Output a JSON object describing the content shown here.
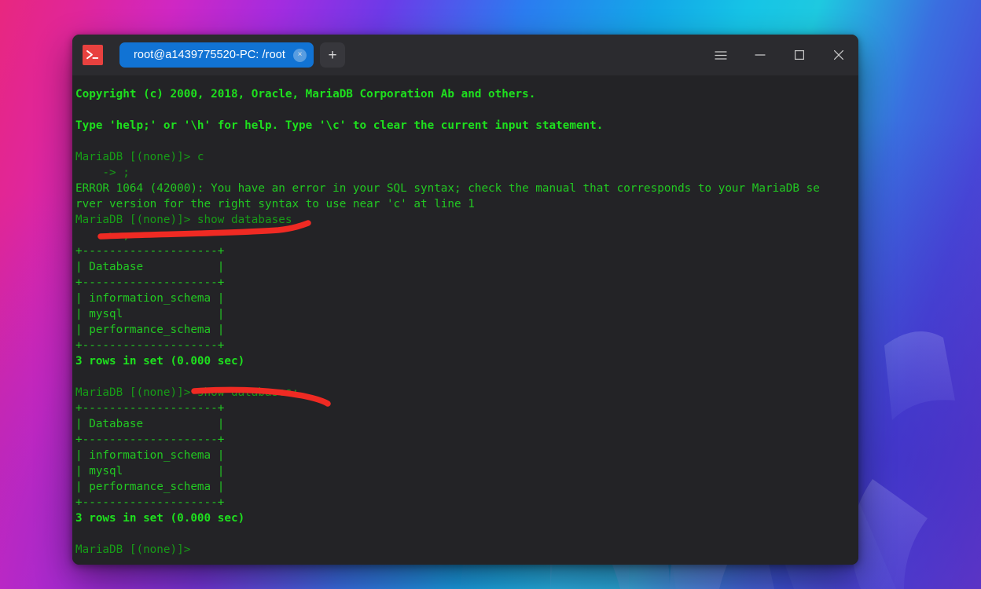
{
  "window": {
    "app_icon": "terminal-prompt-icon",
    "tab": {
      "title": "root@a1439775520-PC: /root",
      "close_label": "×"
    },
    "new_tab_label": "+",
    "controls": {
      "menu": "hamburger-menu-icon",
      "minimize": "minimize-icon",
      "maximize": "maximize-icon",
      "close": "close-icon"
    }
  },
  "terminal": {
    "lines": [
      {
        "text": "Copyright (c) 2000, 2018, Oracle, MariaDB Corporation Ab and others.",
        "style": "bold"
      },
      {
        "text": "",
        "style": "norm"
      },
      {
        "text": "Type 'help;' or '\\h' for help. Type '\\c' to clear the current input statement.",
        "style": "bold"
      },
      {
        "text": "",
        "style": "norm"
      },
      {
        "text": "MariaDB [(none)]> c",
        "style": "dim"
      },
      {
        "text": "    -> ;",
        "style": "dim"
      },
      {
        "text": "ERROR 1064 (42000): You have an error in your SQL syntax; check the manual that corresponds to your MariaDB se",
        "style": "norm"
      },
      {
        "text": "rver version for the right syntax to use near 'c' at line 1",
        "style": "norm"
      },
      {
        "text": "MariaDB [(none)]> show databases",
        "style": "dim"
      },
      {
        "text": "    -> ;",
        "style": "dim"
      },
      {
        "text": "+--------------------+",
        "style": "norm"
      },
      {
        "text": "| Database           |",
        "style": "norm"
      },
      {
        "text": "+--------------------+",
        "style": "norm"
      },
      {
        "text": "| information_schema |",
        "style": "norm"
      },
      {
        "text": "| mysql              |",
        "style": "norm"
      },
      {
        "text": "| performance_schema |",
        "style": "norm"
      },
      {
        "text": "+--------------------+",
        "style": "norm"
      },
      {
        "text": "3 rows in set (0.000 sec)",
        "style": "bold"
      },
      {
        "text": "",
        "style": "norm"
      },
      {
        "text": "MariaDB [(none)]> show databases;",
        "style": "dim"
      },
      {
        "text": "+--------------------+",
        "style": "norm"
      },
      {
        "text": "| Database           |",
        "style": "norm"
      },
      {
        "text": "+--------------------+",
        "style": "norm"
      },
      {
        "text": "| information_schema |",
        "style": "norm"
      },
      {
        "text": "| mysql              |",
        "style": "norm"
      },
      {
        "text": "| performance_schema |",
        "style": "norm"
      },
      {
        "text": "+--------------------+",
        "style": "norm"
      },
      {
        "text": "3 rows in set (0.000 sec)",
        "style": "bold"
      },
      {
        "text": "",
        "style": "norm"
      },
      {
        "text": "MariaDB [(none)]>",
        "style": "dim"
      }
    ]
  },
  "annotations": {
    "color": "#ef2a23",
    "marks": [
      {
        "name": "underline-mark-1",
        "note": "stroke under the '-> ;' continuation prompt line"
      },
      {
        "name": "underline-mark-2",
        "note": "stroke under 'show databases;'"
      }
    ]
  },
  "colors": {
    "terminal_bg": "#232326",
    "titlebar_bg": "#2b2b2f",
    "tab_active": "#1173d4",
    "prompt_green": "#19c319",
    "annotation_red": "#ef2a23"
  }
}
